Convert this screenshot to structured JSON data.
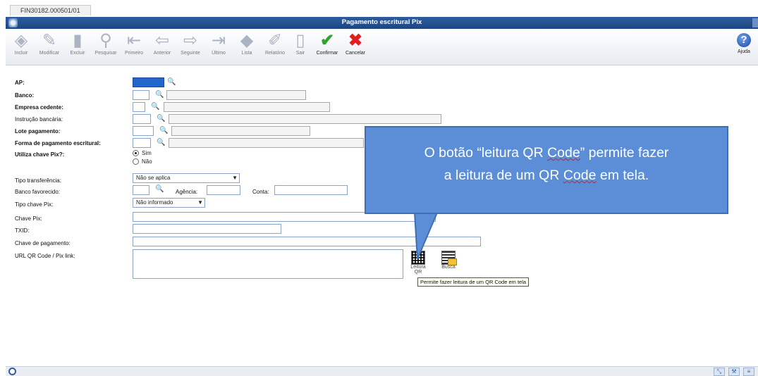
{
  "tab": {
    "label": "FIN30182.000501/01"
  },
  "window": {
    "title": "Pagamento escritural Pix"
  },
  "toolbar": {
    "buttons": [
      {
        "label": "Incluir",
        "icon": "add-icon"
      },
      {
        "label": "Modificar",
        "icon": "edit-icon"
      },
      {
        "label": "Excluir",
        "icon": "delete-icon"
      },
      {
        "label": "Pesquisar",
        "icon": "search-icon"
      },
      {
        "label": "Primeiro",
        "icon": "first-icon"
      },
      {
        "label": "Anterior",
        "icon": "previous-icon"
      },
      {
        "label": "Seguinte",
        "icon": "next-icon"
      },
      {
        "label": "Último",
        "icon": "last-icon"
      },
      {
        "label": "Lista",
        "icon": "list-icon"
      },
      {
        "label": "Relatório",
        "icon": "report-icon"
      },
      {
        "label": "Sair",
        "icon": "exit-icon"
      },
      {
        "label": "Confirmar",
        "icon": "confirm-icon"
      },
      {
        "label": "Cancelar",
        "icon": "cancel-icon"
      }
    ],
    "help_label": "Ajuda"
  },
  "form": {
    "ap": "AP:",
    "banco": "Banco:",
    "empresa_cedente": "Empresa cedente:",
    "instrucao_bancaria": "Instrução bancária:",
    "lote_pagamento": "Lote pagamento:",
    "forma_pagamento": "Forma de pagamento escritural:",
    "utiliza_chave_pix": "Utiliza chave Pix?:",
    "radio_sim": "Sim",
    "radio_nao": "Não",
    "tipo_transferencia": "Tipo transferência:",
    "tipo_transferencia_value": "Não se aplica",
    "banco_favorecido": "Banco favorecido:",
    "agencia": "Agência:",
    "conta": "Conta:",
    "tipo_chave_pix": "Tipo chave Pix:",
    "tipo_chave_pix_value": "Não informado",
    "chave_pix": "Chave Pix:",
    "txid": "TXID:",
    "chave_pagamento": "Chave de pagamento:",
    "url_qr_code": "URL QR Code / Pix link:"
  },
  "qr_buttons": {
    "leitura_label": "Leitura QR",
    "busca_label": "Busca"
  },
  "tooltip": "Permite fazer leitura de um QR Code em tela",
  "callout": {
    "line1_a": "O botão “leitura QR ",
    "line1_u": "Code",
    "line1_b": "” permite fazer",
    "line2_a": "a leitura de um QR ",
    "line2_u": "Code",
    "line2_b": " em tela."
  },
  "colors": {
    "titlebar": "#1d467f",
    "callout": "#5b8ed6",
    "confirm": "#2fa32f",
    "cancel": "#e02020"
  }
}
